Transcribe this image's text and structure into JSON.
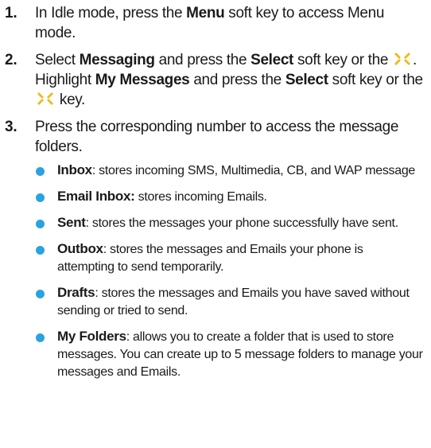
{
  "steps": [
    {
      "num": "1.",
      "parts": [
        {
          "t": "In Idle mode, press the "
        },
        {
          "t": "Menu",
          "b": true
        },
        {
          "t": " soft key to access Menu mode."
        }
      ]
    },
    {
      "num": "2.",
      "parts": [
        {
          "t": "Select "
        },
        {
          "t": "Messaging",
          "b": true
        },
        {
          "t": " and press the "
        },
        {
          "t": "Select",
          "b": true
        },
        {
          "t": " soft key or the "
        },
        {
          "icon": "navigation-key-icon"
        },
        {
          "t": ". Highlight "
        },
        {
          "t": "My Messages",
          "b": true
        },
        {
          "t": " and press the "
        },
        {
          "t": "Select",
          "b": true
        },
        {
          "t": " soft key or the "
        },
        {
          "icon": "navigation-key-icon"
        },
        {
          "t": " key."
        }
      ]
    },
    {
      "num": "3.",
      "parts": [
        {
          "t": "Press the corresponding number to access the message folders."
        }
      ]
    }
  ],
  "folders": [
    {
      "term": "Inbox",
      "desc": ": stores incoming SMS, Multimedia, CB, and WAP message"
    },
    {
      "term": "Email Inbox:",
      "desc": " stores incoming Emails."
    },
    {
      "term": "Sent",
      "desc": ": stores the messages your phone successfully have sent."
    },
    {
      "term": "Outbox",
      "desc": ": stores the messages and Emails your phone is attempting to send temporarily."
    },
    {
      "term": "Drafts",
      "desc": ": stores the messages and Emails you have saved without sending or tried to send."
    },
    {
      "term": "My Folders",
      "desc": ": allows you to create a folder that is used to store messages. You can create up to 5 message folders to manage your messages and Emails."
    }
  ],
  "colors": {
    "bullet": "#2aa3e0",
    "key_icon": "#f2b81c"
  }
}
